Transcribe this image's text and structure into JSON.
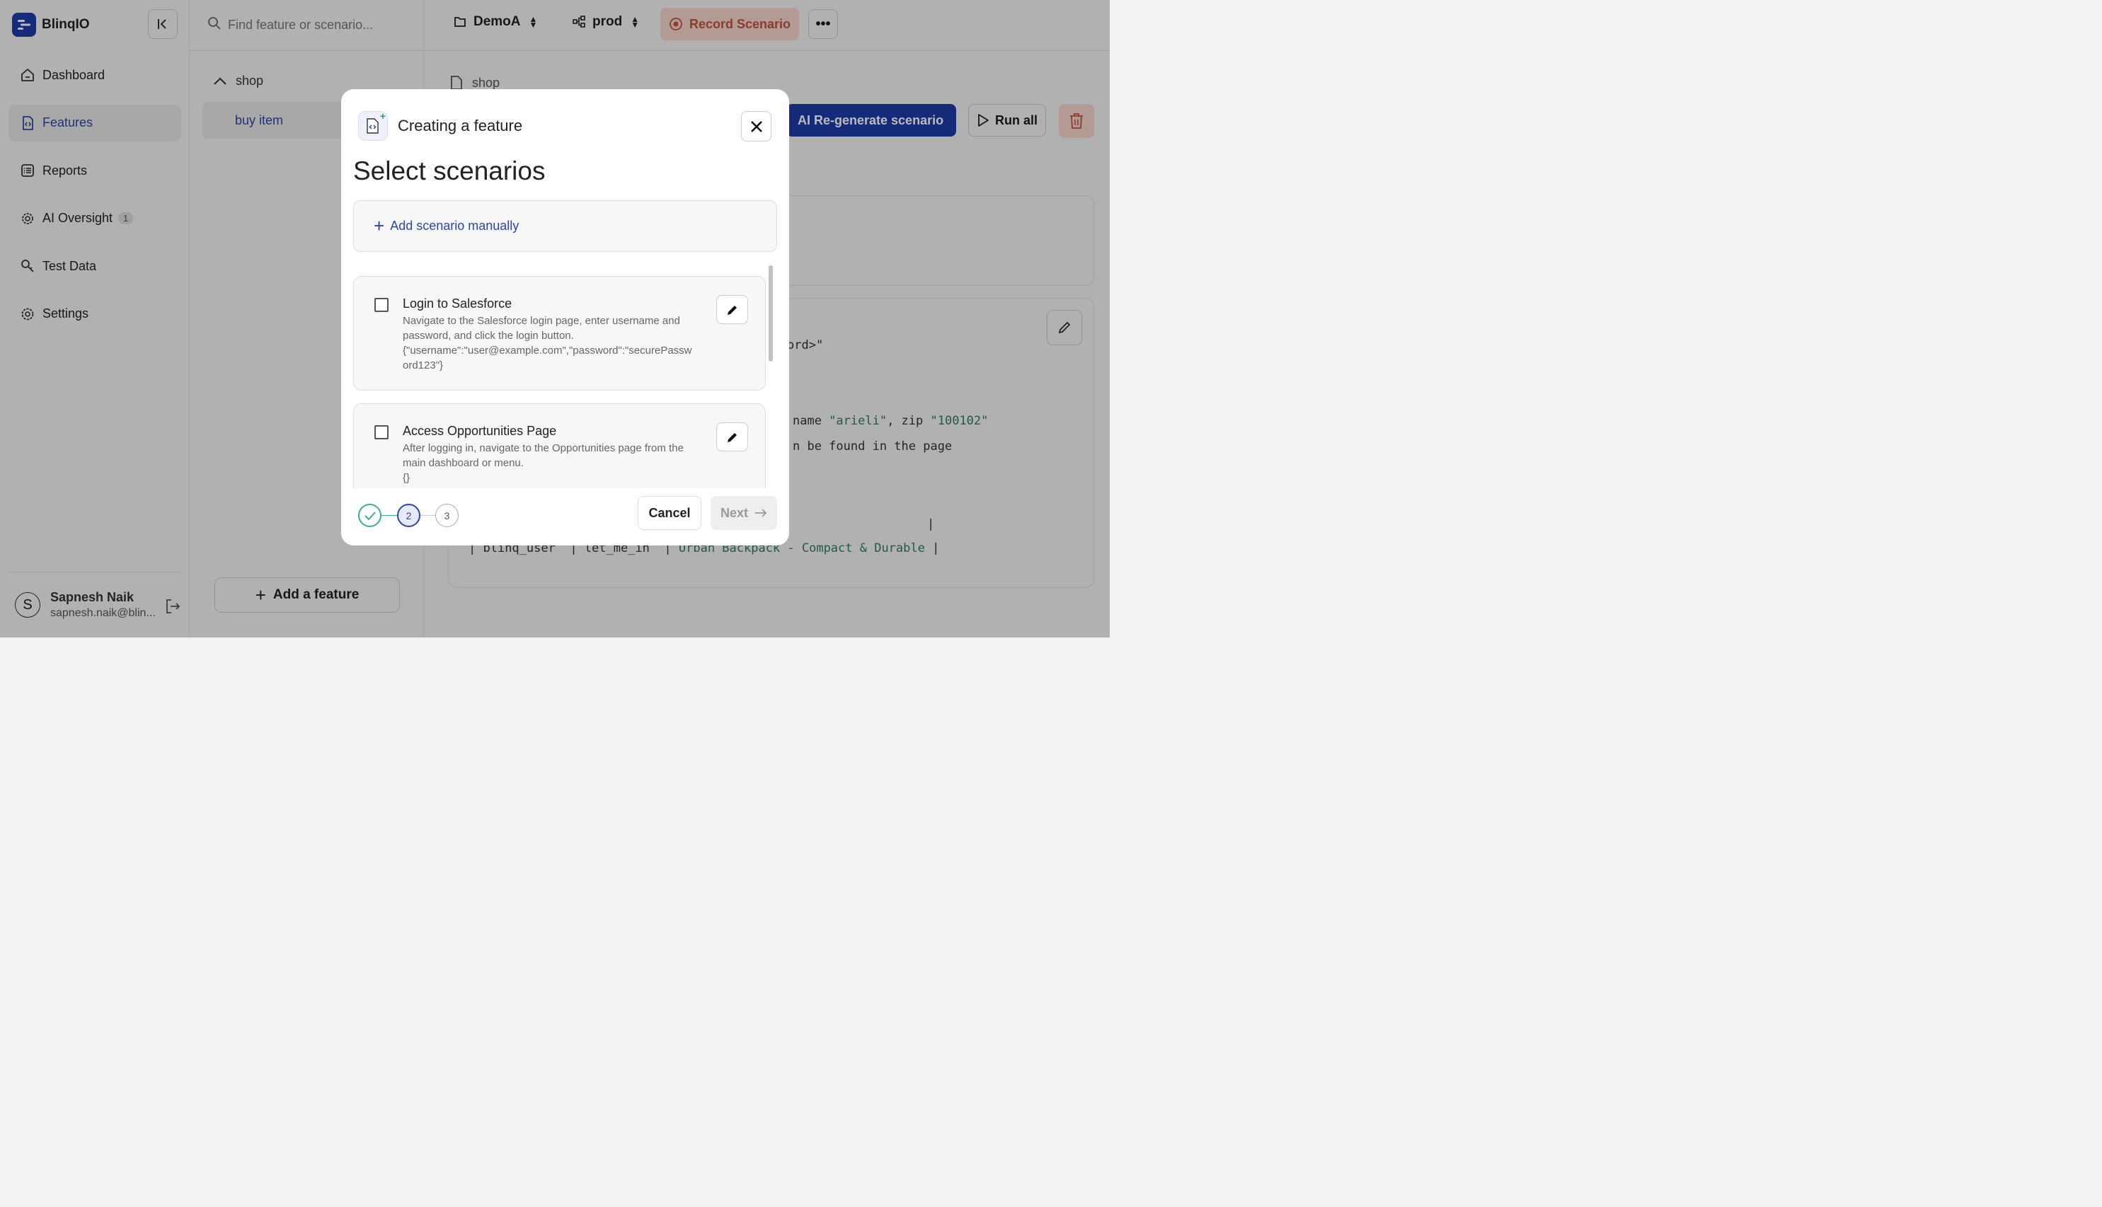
{
  "app": {
    "name": "BlinqIO"
  },
  "sidebar": {
    "items": [
      {
        "label": "Dashboard",
        "icon": "home-icon"
      },
      {
        "label": "Features",
        "icon": "feature-file-icon",
        "active": true
      },
      {
        "label": "Reports",
        "icon": "list-icon"
      },
      {
        "label": "AI Oversight",
        "icon": "gear-check-icon",
        "badge": "1"
      },
      {
        "label": "Test Data",
        "icon": "key-search-icon"
      },
      {
        "label": "Settings",
        "icon": "gear-icon"
      }
    ],
    "user": {
      "initial": "S",
      "name": "Sapnesh Naik",
      "email": "sapnesh.naik@blin..."
    }
  },
  "search": {
    "placeholder": "Find feature or scenario..."
  },
  "tree": {
    "folder": "shop",
    "item": "buy item"
  },
  "add_feature_label": "Add a feature",
  "topbar": {
    "project": "DemoA",
    "env": "prod",
    "record_label": "Record Scenario",
    "more": "•••"
  },
  "main": {
    "breadcrumb": "shop",
    "regen_label": "AI  Re-generate scenario",
    "run_all_label": "Run all"
  },
  "code": {
    "line1": "ord>\"",
    "line2_pre": "name ",
    "line2_s1": "\"arieli\"",
    "line2_mid": ", zip ",
    "line2_s2": "\"100102\"",
    "line3": "n be found in the page",
    "line4": "|",
    "row_c1": "blinq_user",
    "row_c2": "let_me_in",
    "row_c3": "Urban Backpack - Compact & Durable"
  },
  "modal": {
    "title": "Creating a feature",
    "heading": "Select scenarios",
    "add_manual_label": "Add scenario manually",
    "scenarios": [
      {
        "title": "Login to Salesforce",
        "description": "Navigate to the Salesforce login page, enter username and password, and click the login button.",
        "data": "{\"username\":\"user@example.com\",\"password\":\"securePassw ord123\"}",
        "checked": false
      },
      {
        "title": "Access Opportunities Page",
        "description": "After logging in, navigate to the Opportunities page from the main dashboard or menu.",
        "data": "{}",
        "checked": false
      }
    ],
    "steps": [
      "1",
      "2",
      "3"
    ],
    "current_step": 2,
    "cancel_label": "Cancel",
    "next_label": "Next"
  },
  "colors": {
    "accent": "#1f3aa8",
    "record": "#c0533e",
    "success": "#3bae8e"
  }
}
